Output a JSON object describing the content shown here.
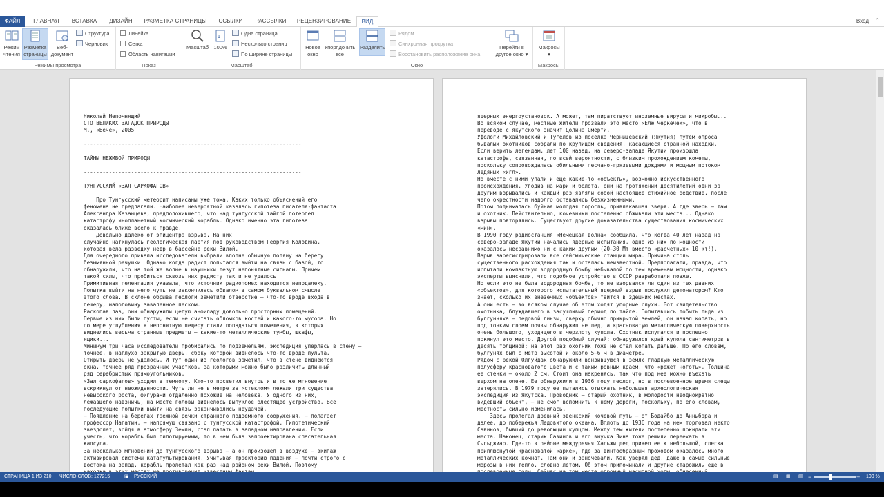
{
  "ribbon_tabs": {
    "file": "ФАЙЛ",
    "home": "ГЛАВНАЯ",
    "insert": "ВСТАВКА",
    "design": "ДИЗАЙН",
    "layout": "РАЗМЕТКА СТРАНИЦЫ",
    "references": "ССЫЛКИ",
    "mailings": "РАССЫЛКИ",
    "review": "РЕЦЕНЗИРОВАНИЕ",
    "view": "ВИД"
  },
  "account": {
    "signin": "Вход"
  },
  "groups": {
    "views": {
      "label": "Режимы просмотра",
      "read_mode": [
        "Режим",
        "чтения"
      ],
      "print_layout": [
        "Разметка",
        "страницы"
      ],
      "web_layout": [
        "Веб-",
        "документ"
      ],
      "outline": "Структура",
      "draft": "Черновик"
    },
    "show": {
      "label": "Показ",
      "ruler": "Линейка",
      "gridlines": "Сетка",
      "nav_pane": "Область навигации"
    },
    "zoom": {
      "label": "Масштаб",
      "zoom": "Масштаб",
      "percent": "100%",
      "one_page": "Одна страница",
      "multiple_pages": "Несколько страниц",
      "page_width": "По ширине страницы"
    },
    "window": {
      "label": "Окно",
      "new_window": [
        "Новое",
        "окно"
      ],
      "arrange_all": [
        "Упорядочить",
        "все"
      ],
      "split": "Разделить",
      "side_by_side": "Рядом",
      "sync_scroll": "Синхронная прокрутка",
      "reset_position": "Восстановить расположение окна",
      "switch_windows": [
        "Перейти в",
        "другое окно ▾"
      ]
    },
    "macros": {
      "label": "Макросы",
      "macros": "Макросы",
      "arrow": "▾"
    }
  },
  "document": {
    "page1": "Николай Непомнящий\nСТО ВЕЛИКИХ ЗАГАДОК ПРИРОДЫ\nМ., «Вече», 2005\n\n---------------------------------------------------------------------\n\nТАЙНЫ НЕЖИВОЙ ПРИРОДЫ\n\n---------------------------------------------------------------------\n\nТУНГУССКИЙ «ЗАЛ САРКОФАГОВ»\n\n    Про Тунгусский метеорит написаны уже тома. Каких только объяснений его\nфеномена не предлагали. Наиболее невероятной казалась гипотеза писателя-фантаста\nАлександра Казанцева, предположившего, что над тунгусской тайгой потерпел\nкатастрофу инопланетный космический корабль. Однако именно эта гипотеза\nоказалась ближе всего к правде.\n    Довольно далеко от эпицентра взрыва. На них\nслучайно наткнулась геологическая партия под руководством Георгия Колодина,\nкоторая вела разведку недр в бассейне реки Вилюй.\nДля очередного привала исследователи выбрали вполне обычную поляну на берегу\nбезымянной речушки. Однако когда радист попытался выйти на связь с базой, то\nобнаружили, что на той же волне в наушники лезут непонятные сигналы. Причем\nтакой силы, что пробиться сквозь них радисту так и не удалось\nПримитивная пеленгация указала, что источник радиопомех находится неподалеку.\nПопытка выйти на него чуть не закончилась обвалом в самом буквальном смысле\nэтого слова. В склоне обрыва геологи заметили отверстие — что-то вроде входа в\nпещеру, наполовину заваленное песком.\nРаскопав лаз, они обнаружили целую анфиладу довольно просторных помещений.\nПервые из них были пусты, если не считать обломков костей и какого-то мусора. Но\nпо мере углубления в непонятную пещеру стали попадаться помещения, в которых\nвиднелись весьма странные предметы — какие-то металлические тумбы, шкафы,\nящики...\nМинимум три часа исследователи пробирались по подземельям, экспедиция уперлась в стену —\nточнее, в наглухо закрытую дверь, сбоку которой виднелось что-то вроде пульта.\nОткрыть дверь не удалось. И тут один из геологов заметил, что в стене виднеются\nокна, точнее ряд прозрачных участков, за которыми можно было различить длинный\nряд серебристых прямоугольников.\n«Зал саркофагов» уходил в темноту. Кто-то посветил внутрь и в то же мгновение\nвскрикнул от неожиданности. Чуть ли не в метре за «стеклом» лежали три существа\nневысокого роста, фигурами отдаленно похожие на человека. У одного из них,\nлежавшего навзничь, на месте головы виднелось выпуклое блестящее устройство. Все\nпоследующие попытки выйти на связь заканчивались неудачей.\n— Появление на берегах таежной речки странного подземного сооружения, — полагает\nпрофессор Нагатин, — напрямую связано с тунгусской катастрофой. Гипотетический\nзвездолет, войдя в атмосферу Земли, стал падать в западном направлении. Если\nучесть, что корабль был пилотируемым, то в нем была запроектирована спасательная\nкапсула.\nЗа несколько мгновений до тунгусского взрыва — а он произошел в воздухе — экипаж\nактивировал системы катапультирования. Учитывая траекторию падения — почти строго с\nвостока на запад, корабль пролетал как раз над районом реки Вилюй. Поэтому\nнаходка в этих местах не противоречит известным фактам.",
    "page2": "ядерных энергоустановок. А может, там пиратствуют иноземные вирусы и микробы...\nВо всяком случае, местные жители прозвали это место «Елю Черкечех», что в\nпереводе с якутского значит Долина Смерти.\nУфологи Михайловский и Тугелов из поселка Чернышевский (Якутия) путем опроса\nбывалых охотников собрали по крупицам сведения, касающиеся странной находки.\nЕсли верить легендам, лет 100 назад, на северо-западе Якутии произошла\nкатастрофа, связанная, по всей вероятности, с близким прохождением кометы,\nпоскольку сопровождалась обильными песчано-грязевыми дождями и мощным потоком\nледяных «игл».\nНо вместе с ними упали и еще какие-то «объекты», возможно искусственного\nпроисхождения. Угодив на мари и болота, они на протяжении десятилетий одни за\nдругим взрывались и каждый раз являли собой настоящее стихийное бедствие, после\nчего окрестности надолго оставались безжизненными.\nПотом поднималась буйная молодая поросль, привлекавшая зверя. А где зверь — там\nи охотник. Действительно, кочевники постепенно обживали эти места... Однако\nвзрывы повторялись. Существуют другие доказательства существования космических\n«мин».\nВ 1990 году радиостанция «Немецкая волна» сообщила, что когда 40 лет назад на\nсеверо-западе Якутии начались ядерные испытания, одно из них по мощности\nоказалось несравнимо ни с каким другим (20–30 Мт вместо «расчетных» 10 кт!).\nВзрыв зарегистрировали все сейсмические станции мира. Причина столь\nсущественного расхождения так и осталась неизвестной. Предполагали, правда, что\nиспытали компактную водородную бомбу небывалой по тем временам мощности, однако\nэксперты выяснили, что подобное устройство в СССР разработали позже.\nНо если это не была водородная бомба, то не взорвался ли один из тех давних\n«объектов», для которого испытательный ядерный взрыв послужил детонатором? Кто\nзнает, сколько их внеземных «объектов» таится в здешних местах.\nА они есть — во всяком случае об этом ходят упорные слухи. Вот свидетельство\nохотника, блуждавшего в засушливый период по тайге. Попытавшись добыть льда из\nбулгунняха — ледовой линзы, сверху обычно прикрытой землей, он начал копать, но\nпод тонким слоем почвы обнаружил не лед, а красноватую металлическую поверхность\nочень большого, уходящего в мерзлоту купола. Охотник испугался и поспешно\nпокинул это место. Другой подобный случай: обнаружился край купола сантиметров в\nдесять толщиной; на этот раз охотник тоже не стал копать дальше. По его словам,\nбулгунях был с метр высотой и около 5–6 м в диаметре.\nРядом с рекой Олгуйдах обнаружили вонзившуюся в землю гладкую металлическую\nполусферу красноватого цвета и с таким ровным краем, что «режет ноготь». Толщина\nее стенки — около 2 см. Стоит она накренясь, так что под нее можно въехать\nверхом на олене. Ее обнаружили в 1936 году геолог, но в послевоенное время следы\nзатерялись. В 1979 году ее пытались отыскать небольшая археологическая\nэкспедиция из Якутска. Проводник — старый охотник, в молодости неоднократно\nвидевший объект, — не смог вспомнить к нему дороги, поскольку, по его словам,\nместность сильно изменилась.\n    Здесь пролегал древний эвенкский кочевой путь — от Бодайбо до Анныбара и\nдалее, до побережья Ледовитого океана. Вплоть до 1936 года на нем торговал некто\nСавинов, бывший до революции купцом. Между тем жители постепенно покидали эти\nместа. Наконец, старик Савинов и его внучка Зина тоже решили переехать в\nСыльджиар. Где-то в районе междуречья Хальжи дед привел ее к небольшой, слегка\nприплюснутой красноватой «арке», где за винтообразным проходом оказалось много\nметаллических комнат. Там они и заночевали. Как уверял дед, даже в самые сильные\nморозы в них тепло, словно летом. Об этом припоминали и другие старожилы еще в\nпослевоенные годы. Сейчас на том месте огромный насыпной холм, обнесенный"
  },
  "status": {
    "page": "СТРАНИЦА 1 ИЗ 210",
    "words": "ЧИСЛО СЛОВ: 127215",
    "language": "РУССКИЙ",
    "zoom": "100 %",
    "minus": "−",
    "plus": "+"
  }
}
